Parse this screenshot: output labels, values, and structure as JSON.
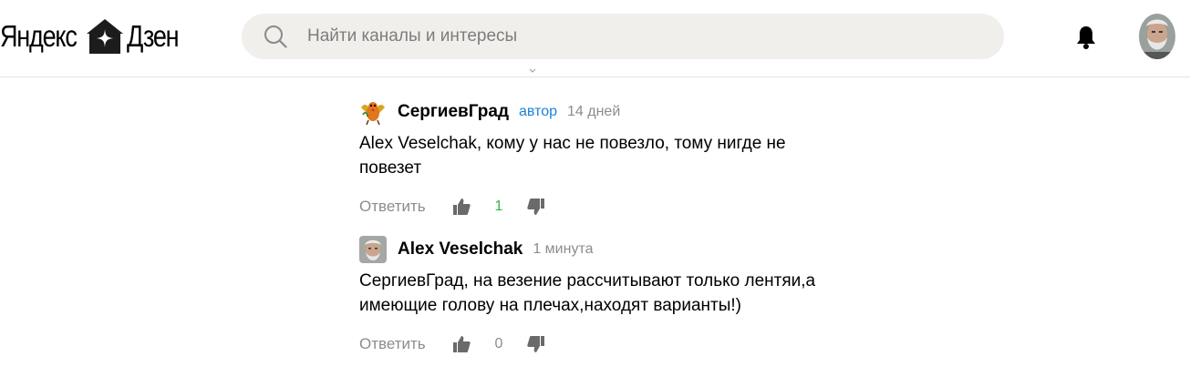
{
  "header": {
    "logo_left": "Яндекс",
    "logo_right": "Дзен",
    "search_placeholder": "Найти каналы и интересы"
  },
  "comments": [
    {
      "author": "СергиевГрад",
      "badge": "автор",
      "time": "14 дней",
      "text_line1": "Alex Veselchak, кому у нас не повезло, тому нигде не",
      "text_line2": "повезет",
      "reply_label": "Ответить",
      "likes": "1"
    },
    {
      "author": "Alex Veselchak",
      "time": "1 минута",
      "text_line1": "СергиевГрад, на везение рассчитывают только лентяи,а",
      "text_line2": "имеющие голову на плечах,находят варианты!)",
      "reply_label": "Ответить",
      "likes": "0"
    }
  ],
  "colors": {
    "author_badge": "#1a82dc",
    "positive_count": "#2dbb3f",
    "muted": "#8c8c8c",
    "search_bg": "#f0efeb"
  },
  "icons": [
    "search-icon",
    "bell-icon",
    "thumbs-up-icon",
    "thumbs-down-icon",
    "zen-house-icon"
  ]
}
